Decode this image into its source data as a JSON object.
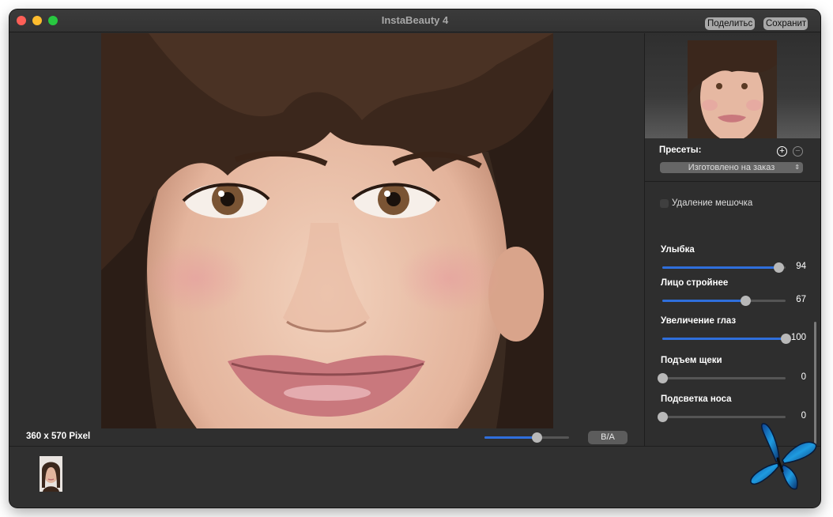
{
  "window": {
    "title": "InstaBeauty 4",
    "buttons": {
      "share": "Поделитьс",
      "save": "Сохранит"
    }
  },
  "canvas": {
    "pixel_info": "360 x 570 Pixel",
    "zoom_level": 0.62,
    "ba_button": "B/A"
  },
  "panel": {
    "presets_label": "Пресеты:",
    "preset_selected": "Изготовлено на заказ",
    "checkbox_label": "Удаление мешочка",
    "checkbox_checked": false,
    "adjustments": [
      {
        "label": "Улыбка",
        "value": "94",
        "level": 94
      },
      {
        "label": "Лицо стройнее",
        "value": "67",
        "level": 67
      },
      {
        "label": "Увеличение глаз",
        "value": "100",
        "level": 100
      },
      {
        "label": "Подъем щеки",
        "value": "0",
        "level": 0
      },
      {
        "label": "Подсветка носа",
        "value": "0",
        "level": 0
      }
    ]
  },
  "colors": {
    "accent": "#2f6fdc",
    "background": "#2e2e2e",
    "butterfly": "#1e9be0"
  },
  "icons": [
    "close-icon",
    "minimize-icon",
    "maximize-icon",
    "plus-icon",
    "minus-icon",
    "chevron-updown-icon",
    "butterfly-logo"
  ]
}
